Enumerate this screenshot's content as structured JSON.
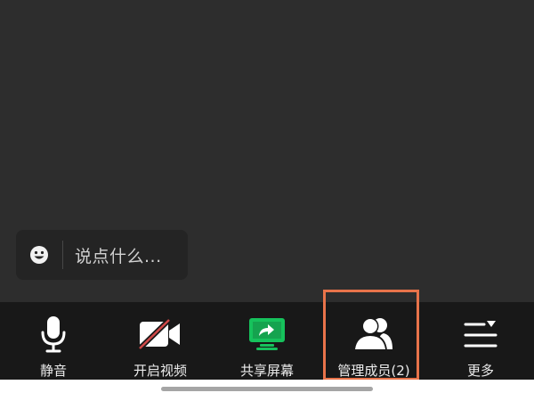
{
  "chat": {
    "emoji_icon": "smiley-icon",
    "placeholder": "说点什么..."
  },
  "toolbar": {
    "items": [
      {
        "id": "mute",
        "label": "静音",
        "icon": "microphone-icon"
      },
      {
        "id": "video",
        "label": "开启视频",
        "icon": "video-camera-off-icon"
      },
      {
        "id": "share",
        "label": "共享屏幕",
        "icon": "share-screen-icon"
      },
      {
        "id": "members",
        "label": "管理成员(2)",
        "icon": "members-icon",
        "highlighted": true
      },
      {
        "id": "more",
        "label": "更多",
        "icon": "more-menu-icon"
      }
    ]
  },
  "colors": {
    "background": "#2d2d2d",
    "toolbar": "#181818",
    "highlight": "#e8734a",
    "share_green": "#16c25c",
    "video_slash": "#d04848"
  }
}
